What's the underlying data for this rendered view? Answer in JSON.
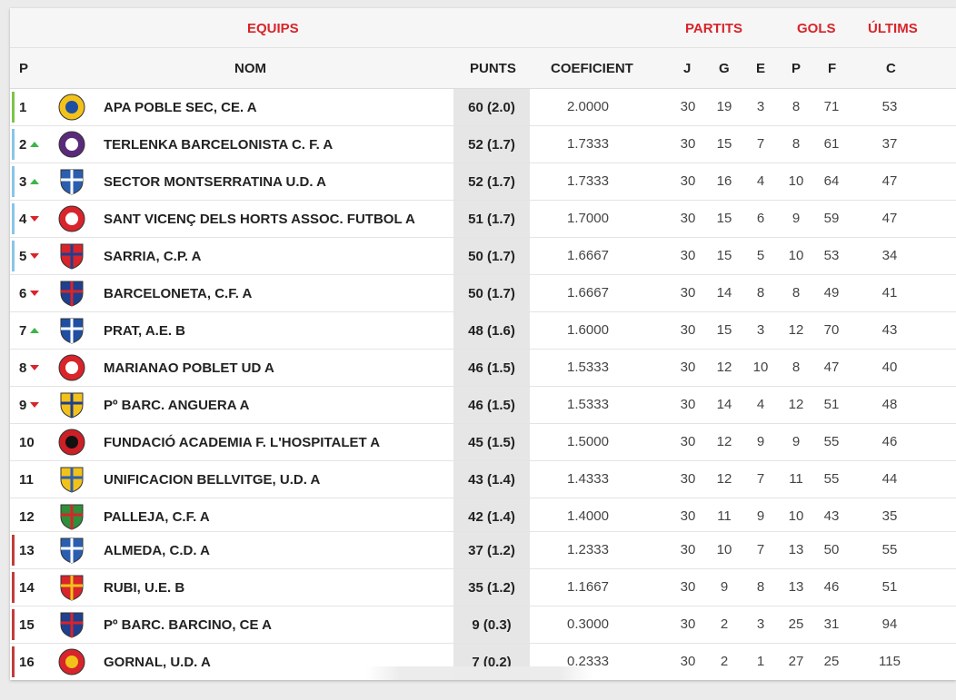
{
  "groups": {
    "equips": "EQUIPS",
    "partits": "PARTITS",
    "gols": "GOLS",
    "ultims": "ÚLTIMS"
  },
  "columns": {
    "p": "P",
    "nom": "NOM",
    "punts": "PUNTS",
    "coeficient": "COEFICIENT",
    "j": "J",
    "g": "G",
    "e": "E",
    "pp": "P",
    "f": "F",
    "c": "C"
  },
  "colors": {
    "accent": "#d8242a",
    "up": "#3cb54a",
    "promotion": "#7cc44a",
    "playoff": "#8ac4e6",
    "relegation": "#c43b3b"
  },
  "rows": [
    {
      "pos": "1",
      "trend": "none",
      "zone": "promotion",
      "crest": "yellow-blue-crest-icon",
      "name": "APA POBLE SEC, CE. A",
      "punts": "60 (2.0)",
      "coef": "2.0000",
      "j": "30",
      "g": "19",
      "e": "3",
      "p": "8",
      "f": "71",
      "c": "53"
    },
    {
      "pos": "2",
      "trend": "up",
      "zone": "playoff",
      "crest": "purple-round-crest-icon",
      "name": "TERLENKA BARCELONISTA C. F. A",
      "punts": "52 (1.7)",
      "coef": "1.7333",
      "j": "30",
      "g": "15",
      "e": "7",
      "p": "8",
      "f": "61",
      "c": "37"
    },
    {
      "pos": "3",
      "trend": "up",
      "zone": "playoff",
      "crest": "blue-white-shield-icon",
      "name": "SECTOR MONTSERRATINA U.D. A",
      "punts": "52 (1.7)",
      "coef": "1.7333",
      "j": "30",
      "g": "16",
      "e": "4",
      "p": "10",
      "f": "64",
      "c": "47"
    },
    {
      "pos": "4",
      "trend": "down",
      "zone": "playoff",
      "crest": "red-round-crest-icon",
      "name": "SANT VICENÇ DELS HORTS ASSOC. FUTBOL A",
      "punts": "51 (1.7)",
      "coef": "1.7000",
      "j": "30",
      "g": "15",
      "e": "6",
      "p": "9",
      "f": "59",
      "c": "47"
    },
    {
      "pos": "5",
      "trend": "down",
      "zone": "playoff",
      "crest": "red-blue-shield-icon",
      "name": "SARRIA, C.P. A",
      "punts": "50 (1.7)",
      "coef": "1.6667",
      "j": "30",
      "g": "15",
      "e": "5",
      "p": "10",
      "f": "53",
      "c": "34"
    },
    {
      "pos": "6",
      "trend": "down",
      "zone": "none",
      "crest": "striped-shield-icon",
      "name": "BARCELONETA, C.F. A",
      "punts": "50 (1.7)",
      "coef": "1.6667",
      "j": "30",
      "g": "14",
      "e": "8",
      "p": "8",
      "f": "49",
      "c": "41"
    },
    {
      "pos": "7",
      "trend": "up",
      "zone": "none",
      "crest": "blue-plane-shield-icon",
      "name": "PRAT, A.E. B",
      "punts": "48 (1.6)",
      "coef": "1.6000",
      "j": "30",
      "g": "15",
      "e": "3",
      "p": "12",
      "f": "70",
      "c": "43"
    },
    {
      "pos": "8",
      "trend": "down",
      "zone": "none",
      "crest": "red-round-crest-icon",
      "name": "MARIANAO POBLET UD A",
      "punts": "46 (1.5)",
      "coef": "1.5333",
      "j": "30",
      "g": "12",
      "e": "10",
      "p": "8",
      "f": "47",
      "c": "40"
    },
    {
      "pos": "9",
      "trend": "down",
      "zone": "none",
      "crest": "yellow-a-crest-icon",
      "name": "Pº BARC. ANGUERA A",
      "punts": "46 (1.5)",
      "coef": "1.5333",
      "j": "30",
      "g": "14",
      "e": "4",
      "p": "12",
      "f": "51",
      "c": "48"
    },
    {
      "pos": "10",
      "trend": "none",
      "zone": "none",
      "crest": "red-black-round-crest-icon",
      "name": "FUNDACIÓ ACADEMIA F. L'HOSPITALET A",
      "punts": "45 (1.5)",
      "coef": "1.5000",
      "j": "30",
      "g": "12",
      "e": "9",
      "p": "9",
      "f": "55",
      "c": "46"
    },
    {
      "pos": "11",
      "trend": "none",
      "zone": "none",
      "crest": "yellow-shield-icon",
      "name": "UNIFICACION BELLVITGE, U.D. A",
      "punts": "43 (1.4)",
      "coef": "1.4333",
      "j": "30",
      "g": "12",
      "e": "7",
      "p": "11",
      "f": "55",
      "c": "44"
    },
    {
      "pos": "12",
      "trend": "none",
      "zone": "none",
      "crest": "green-red-crest-icon",
      "name": "PALLEJA, C.F. A",
      "punts": "42 (1.4)",
      "coef": "1.4000",
      "j": "30",
      "g": "11",
      "e": "9",
      "p": "10",
      "f": "43",
      "c": "35"
    },
    {
      "pos": "13",
      "trend": "none",
      "zone": "relegation",
      "crest": "blue-white-shield-icon",
      "name": "ALMEDA, C.D. A",
      "punts": "37 (1.2)",
      "coef": "1.2333",
      "j": "30",
      "g": "10",
      "e": "7",
      "p": "13",
      "f": "50",
      "c": "55"
    },
    {
      "pos": "14",
      "trend": "none",
      "zone": "relegation",
      "crest": "red-yellow-shield-icon",
      "name": "RUBI, U.E. B",
      "punts": "35 (1.2)",
      "coef": "1.1667",
      "j": "30",
      "g": "9",
      "e": "8",
      "p": "13",
      "f": "46",
      "c": "51"
    },
    {
      "pos": "15",
      "trend": "none",
      "zone": "relegation",
      "crest": "blue-red-shield-icon",
      "name": "Pº BARC. BARCINO, CE A",
      "punts": "9 (0.3)",
      "coef": "0.3000",
      "j": "30",
      "g": "2",
      "e": "3",
      "p": "25",
      "f": "31",
      "c": "94"
    },
    {
      "pos": "16",
      "trend": "none",
      "zone": "relegation",
      "crest": "red-yellow-round-crest-icon",
      "name": "GORNAL, U.D. A",
      "punts": "7 (0.2)",
      "coef": "0.2333",
      "j": "30",
      "g": "2",
      "e": "1",
      "p": "27",
      "f": "25",
      "c": "115"
    }
  ]
}
